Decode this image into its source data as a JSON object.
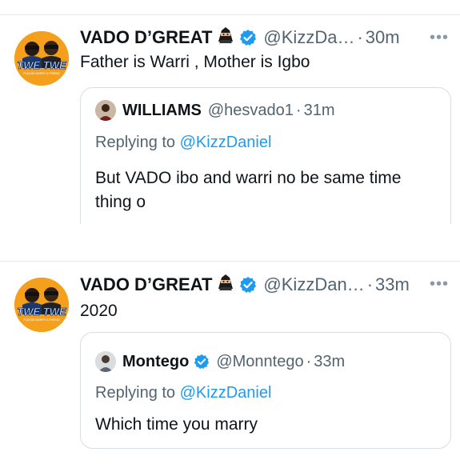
{
  "tweets": [
    {
      "name": "VADO D’GREAT",
      "handle": "@KizzDa…",
      "time": "30m",
      "more": "•••",
      "text": "Father is Warri , Mother is Igbo",
      "avatar_text": "TWE TWE",
      "avatar_sub": "PLEASE MARRY A FRIEND",
      "quote": {
        "name": "WILLIAMS",
        "handle": "@hesvado1",
        "time": "31m",
        "replying_prefix": "Replying to",
        "replying_mention": "@KizzDaniel",
        "text": "But VADO ibo and warri no be same time thing o"
      }
    },
    {
      "name": "VADO D’GREAT",
      "handle": "@KizzDan…",
      "time": "33m",
      "more": "•••",
      "text": "2020",
      "avatar_text": "TWE TWE",
      "avatar_sub": "PLEASE MARRY A FRIEND",
      "quote": {
        "name": "Montego",
        "handle": "@Monntego",
        "time": "33m",
        "replying_prefix": "Replying to",
        "replying_mention": "@KizzDaniel",
        "text": "Which time you marry"
      }
    }
  ],
  "colors": {
    "verified": "#1d9bf0",
    "mention": "#1d9bf0",
    "muted": "#536471",
    "avatar_bg": "#f4a01c"
  },
  "separator": "·"
}
